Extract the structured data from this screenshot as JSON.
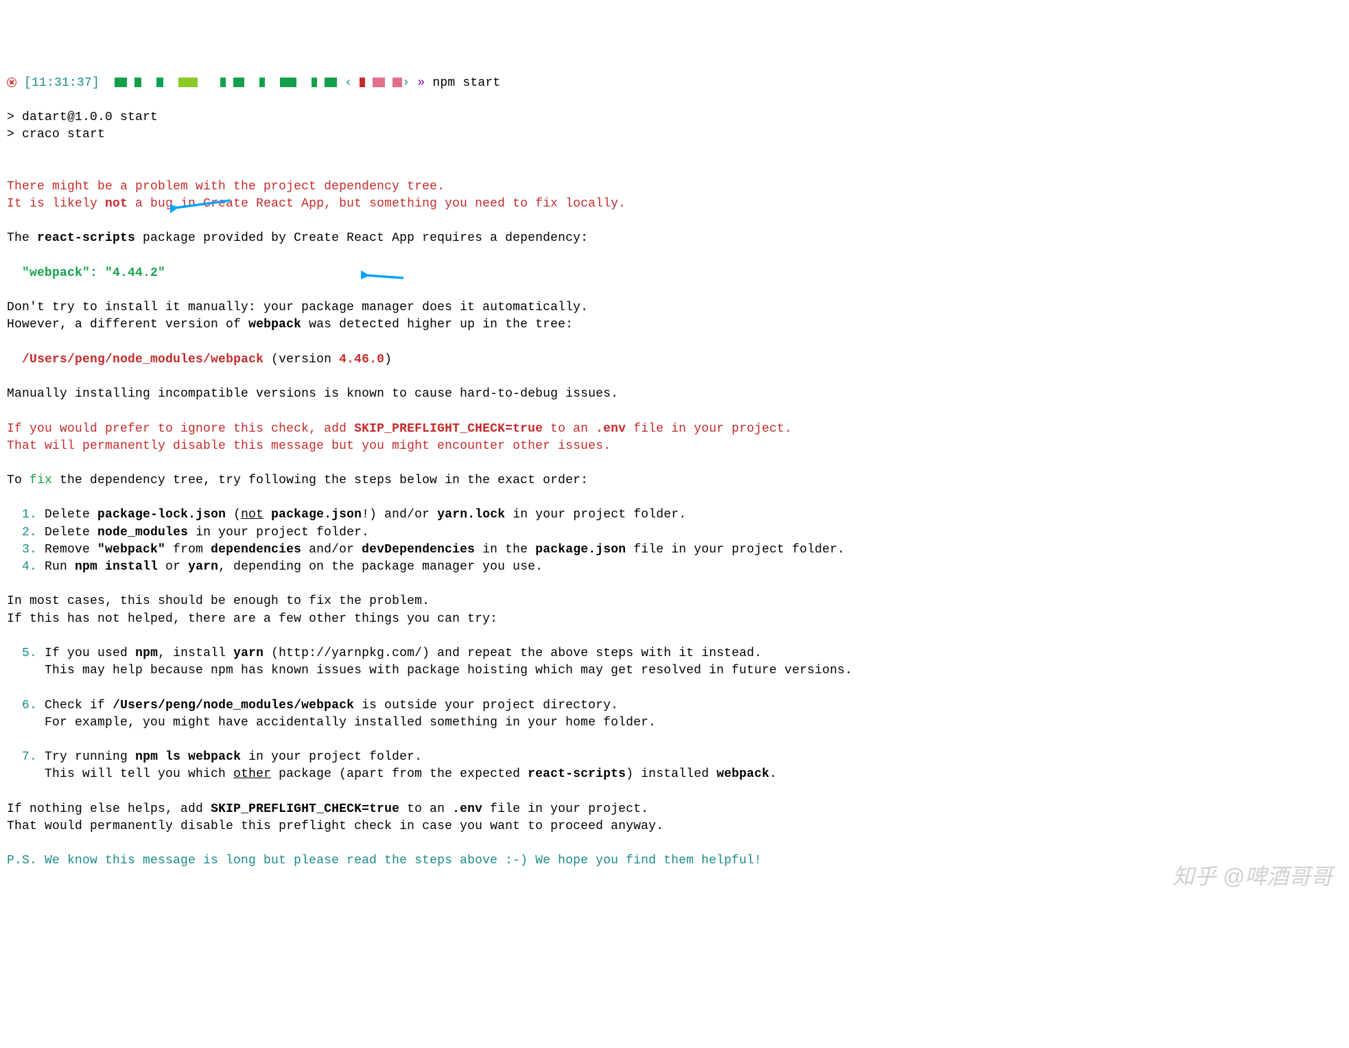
{
  "prompt": {
    "time": "[11:31:37]",
    "sep1": "‹",
    "sep2": "›",
    "arrow": "»",
    "cmd": "npm start"
  },
  "run": {
    "line1": "> datart@1.0.0 start",
    "line2": "> craco start"
  },
  "warn": {
    "l1": "There might be a problem with the project dependency tree.",
    "l2a": "It is likely ",
    "l2b": "not",
    "l2c": " a bug in Create React App, but something you need to fix locally."
  },
  "reqLine": {
    "a": "The ",
    "b": "react-scripts",
    "c": " package provided by Create React App requires a dependency:"
  },
  "dep": "\"webpack\": \"4.44.2\"",
  "dont": {
    "l1": "Don't try to install it manually: your package manager does it automatically.",
    "l2a": "However, a different version of ",
    "l2b": "webpack",
    "l2c": " was detected higher up in the tree:"
  },
  "found": {
    "path": "/Users/peng/node_modules/webpack",
    "mid": " (version ",
    "ver": "4.46.0",
    "end": ")"
  },
  "manual": "Manually installing incompatible versions is known to cause hard-to-debug issues.",
  "skip": {
    "l1a": "If you would prefer to ignore this check, add ",
    "l1b": "SKIP_PREFLIGHT_CHECK=true",
    "l1c": " to an ",
    "l1d": ".env",
    "l1e": " file in your project.",
    "l2": "That will permanently disable this message but you might encounter other issues."
  },
  "fixIntro": {
    "a": "To ",
    "b": "fix",
    "c": " the dependency tree, try following the steps below in the exact order:"
  },
  "steps": {
    "n1": "1.",
    "n2": "2.",
    "n3": "3.",
    "n4": "4.",
    "n5": "5.",
    "n6": "6.",
    "n7": "7.",
    "s1a": " Delete ",
    "s1b": "package-lock.json",
    "s1c": " (",
    "s1d": "not",
    "s1e": " ",
    "s1f": "package.json",
    "s1g": "!) and/or ",
    "s1h": "yarn.lock",
    "s1i": " in your project folder.",
    "s2a": " Delete ",
    "s2b": "node_modules",
    "s2c": " in your project folder.",
    "s3a": " Remove ",
    "s3b": "\"webpack\"",
    "s3c": " from ",
    "s3d": "dependencies",
    "s3e": " and/or ",
    "s3f": "devDependencies",
    "s3g": " in the ",
    "s3h": "package.json",
    "s3i": " file in your project folder.",
    "s4a": " Run ",
    "s4b": "npm install",
    "s4c": " or ",
    "s4d": "yarn",
    "s4e": ", depending on the package manager you use."
  },
  "most": {
    "l1": "In most cases, this should be enough to fix the problem.",
    "l2": "If this has not helped, there are a few other things you can try:"
  },
  "s5": {
    "a": " If you used ",
    "b": "npm",
    "c": ", install ",
    "d": "yarn",
    "e": " (http://yarnpkg.com/) and repeat the above steps with it instead.",
    "l2": "     This may help because npm has known issues with package hoisting which may get resolved in future versions."
  },
  "s6": {
    "a": " Check if ",
    "b": "/Users/peng/node_modules/webpack",
    "c": " is outside your project directory.",
    "l2": "     For example, you might have accidentally installed something in your home folder."
  },
  "s7": {
    "a": " Try running ",
    "b": "npm ls webpack",
    "c": " in your project folder.",
    "l2a": "     This will tell you which ",
    "l2b": "other",
    "l2c": " package (apart from the expected ",
    "l2d": "react-scripts",
    "l2e": ") installed ",
    "l2f": "webpack",
    "l2g": "."
  },
  "nothing": {
    "l1a": "If nothing else helps, add ",
    "l1b": "SKIP_PREFLIGHT_CHECK=true",
    "l1c": " to an ",
    "l1d": ".env",
    "l1e": " file in your project.",
    "l2": "That would permanently disable this preflight check in case you want to proceed anyway."
  },
  "ps": "P.S. We know this message is long but please read the steps above :-) We hope you find them helpful!",
  "watermark": "知乎 @啤酒哥哥"
}
